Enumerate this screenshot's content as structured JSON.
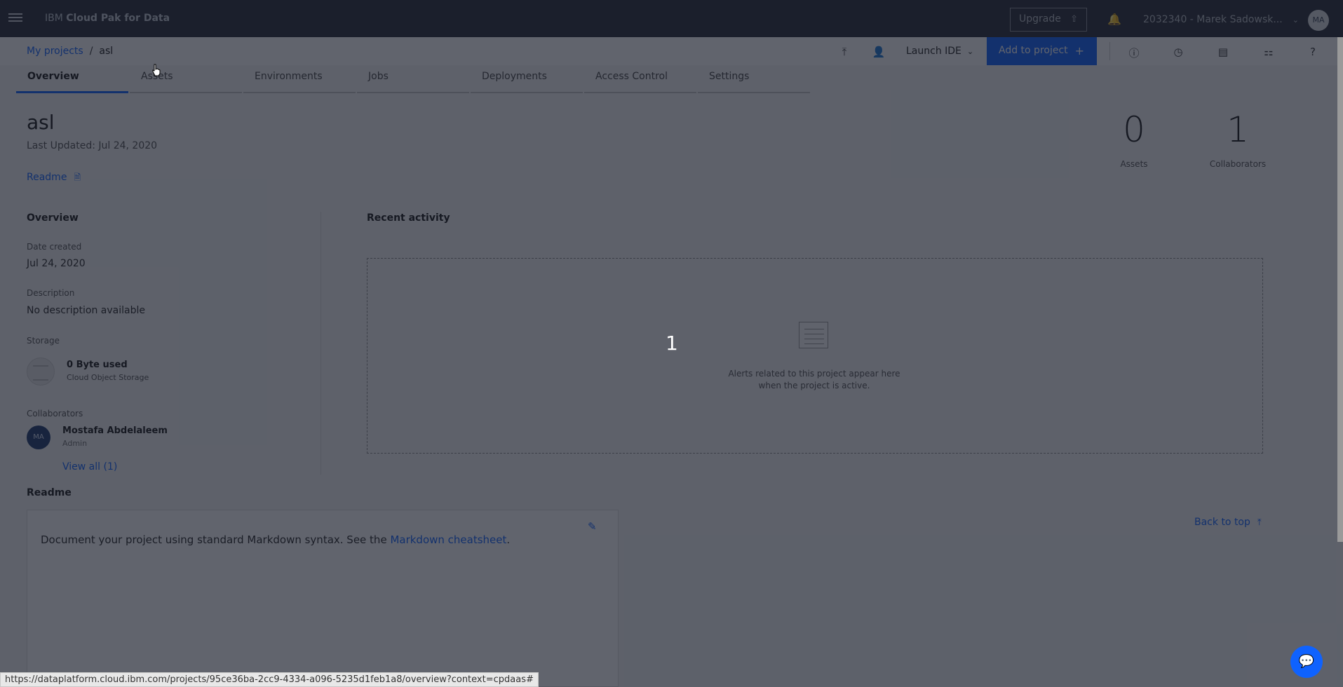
{
  "header": {
    "brand_prefix": "IBM",
    "brand_name": "Cloud Pak for Data",
    "upgrade_label": "Upgrade",
    "account_label": "2032340 - Marek Sadowsk...",
    "avatar_initials": "MA"
  },
  "breadcrumb": {
    "root": "My projects",
    "separator": "/",
    "current": "asl"
  },
  "toolbar": {
    "launch_ide_label": "Launch IDE",
    "add_to_project_label": "Add to project",
    "icons": [
      "upload-icon",
      "add-collaborator-icon",
      "info-icon",
      "history-icon",
      "notes-icon",
      "assets-icon",
      "help-icon"
    ]
  },
  "tabs": [
    {
      "label": "Overview",
      "active": true
    },
    {
      "label": "Assets",
      "active": false
    },
    {
      "label": "Environments",
      "active": false
    },
    {
      "label": "Jobs",
      "active": false
    },
    {
      "label": "Deployments",
      "active": false
    },
    {
      "label": "Access Control",
      "active": false
    },
    {
      "label": "Settings",
      "active": false
    }
  ],
  "project": {
    "title": "asl",
    "last_updated": "Last Updated: Jul 24, 2020",
    "readme_link": "Readme"
  },
  "stats": {
    "assets_count": "0",
    "assets_label": "Assets",
    "collaborators_count": "1",
    "collaborators_label": "Collaborators"
  },
  "overview": {
    "heading": "Overview",
    "date_created_label": "Date created",
    "date_created_value": "Jul 24, 2020",
    "description_label": "Description",
    "description_value": "No description available",
    "storage_label": "Storage",
    "storage_used": "0 Byte used",
    "storage_provider": "Cloud Object Storage",
    "collaborators_label": "Collaborators",
    "collaborator_initials": "MA",
    "collaborator_name": "Mostafa Abdelaleem",
    "collaborator_role": "Admin",
    "view_all": "View all (1)"
  },
  "activity": {
    "heading": "Recent activity",
    "empty_line1": "Alerts related to this project appear here",
    "empty_line2": "when the project is active.",
    "overlay_number": "1"
  },
  "readme": {
    "heading": "Readme",
    "text_before": "Document your project using standard Markdown syntax. See the ",
    "link_text": "Markdown cheatsheet",
    "text_after": "."
  },
  "back_to_top": "Back to top",
  "status_url": "https://dataplatform.cloud.ibm.com/projects/95ce36ba-2cc9-4334-a096-5235d1feb1a8/overview?context=cpdaas#",
  "colors": {
    "accent": "#0f62fe",
    "header_bg": "#262b36",
    "overlay": "rgba(22,27,40,0.68)"
  }
}
